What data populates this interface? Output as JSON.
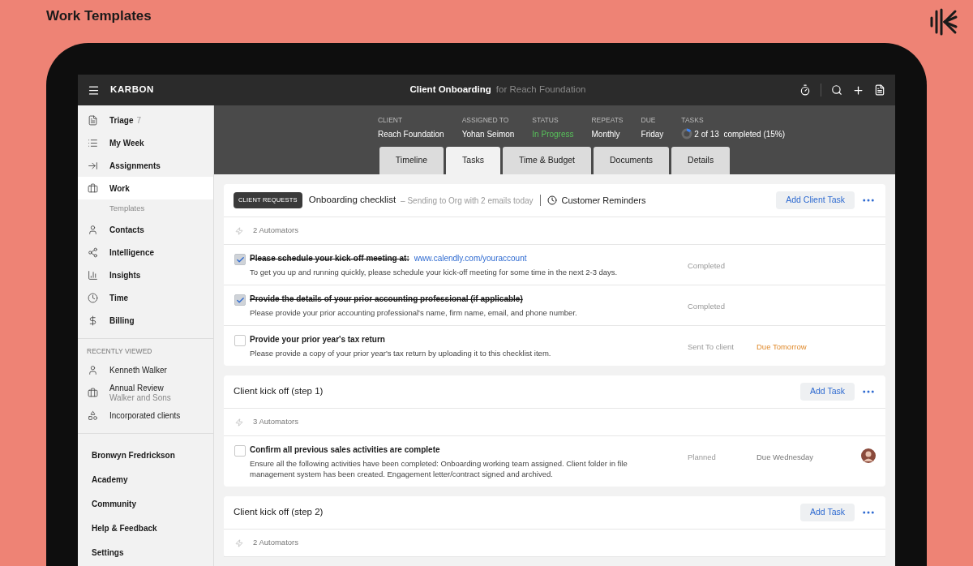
{
  "page_title": "Work Templates",
  "app": {
    "brand": "KARBON",
    "title": "Client Onboarding",
    "title_suffix": "for Reach Foundation"
  },
  "sidebar": {
    "nav": [
      {
        "label": "Triage",
        "count": "7",
        "selected": false
      },
      {
        "label": "My Week",
        "selected": false
      },
      {
        "label": "Assignments",
        "selected": false
      },
      {
        "label": "Work",
        "selected": true,
        "sub": "Templates"
      },
      {
        "label": "Contacts",
        "selected": false
      },
      {
        "label": "Intelligence",
        "selected": false
      },
      {
        "label": "Insights",
        "selected": false
      },
      {
        "label": "Time",
        "selected": false
      },
      {
        "label": "Billing",
        "selected": false
      }
    ],
    "recent_heading": "RECENTLY VIEWED",
    "recent": [
      {
        "label": "Kenneth Walker"
      },
      {
        "label": "Annual Review",
        "subtitle": "Walker and Sons"
      },
      {
        "label": "Incorporated clients"
      }
    ],
    "footer": [
      "Bronwyn Fredrickson",
      "Academy",
      "Community",
      "Help & Feedback",
      "Settings"
    ]
  },
  "summary": [
    {
      "label": "CLIENT",
      "value": "Reach Foundation",
      "kind": "text"
    },
    {
      "label": "ASSIGNED TO",
      "value": "Yohan Seimon",
      "kind": "text"
    },
    {
      "label": "STATUS",
      "value": "In Progress",
      "kind": "status"
    },
    {
      "label": "REPEATS",
      "value": "Monthly",
      "kind": "text"
    },
    {
      "label": "DUE",
      "value": "Friday",
      "kind": "text"
    },
    {
      "label": "TASKS",
      "value": "2 of 13  completed (15%)",
      "kind": "progress",
      "level": 0.15
    }
  ],
  "tabs": [
    {
      "label": "Timeline",
      "selected": false
    },
    {
      "label": "Tasks",
      "selected": true
    },
    {
      "label": "Time & Budget",
      "selected": false
    },
    {
      "label": "Documents",
      "selected": false
    },
    {
      "label": "Details",
      "selected": false
    }
  ],
  "sections": [
    {
      "badge": "CLIENT REQUESTS",
      "title": "Onboarding checklist",
      "subtitle": "– Sending to Org with 2 emails today",
      "reminder": "Customer Reminders",
      "button": "Add Client Task",
      "automators": "2 Automators",
      "tasks": [
        {
          "title": "Please schedule your kick-off meeting at:",
          "link": "www.calendly.com/youraccount",
          "description": "To get you up and running quickly, please schedule your kick-off meeting for some time in the next 2-3 days.",
          "checked": true,
          "status": "Completed"
        },
        {
          "title": "Provide the details of your prior accounting professional (if applicable)",
          "description": "Please provide your prior accounting professional's name, firm name, email, and phone number.",
          "checked": true,
          "status": "Completed"
        },
        {
          "title": "Provide your prior year's tax return",
          "description": "Please provide a copy of your prior year's tax return by uploading it to this checklist item.",
          "checked": false,
          "status": "Sent To client",
          "due": "Due Tomorrow",
          "urgent": true
        }
      ]
    },
    {
      "title": "Client kick off (step 1)",
      "button": "Add Task",
      "automators": "3 Automators",
      "tasks": [
        {
          "title": "Confirm all previous sales activities are complete",
          "description": "Ensure all the following activities have been completed: Onboarding working team assigned. Client folder in file management system has been created. Engagement letter/contract signed and archived.",
          "checked": false,
          "status": "Planned",
          "due": "Due Wednesday",
          "urgent": false,
          "assignee": true
        }
      ]
    },
    {
      "title": "Client kick off (step 2)",
      "button": "Add Task",
      "automators": "2 Automators"
    }
  ]
}
